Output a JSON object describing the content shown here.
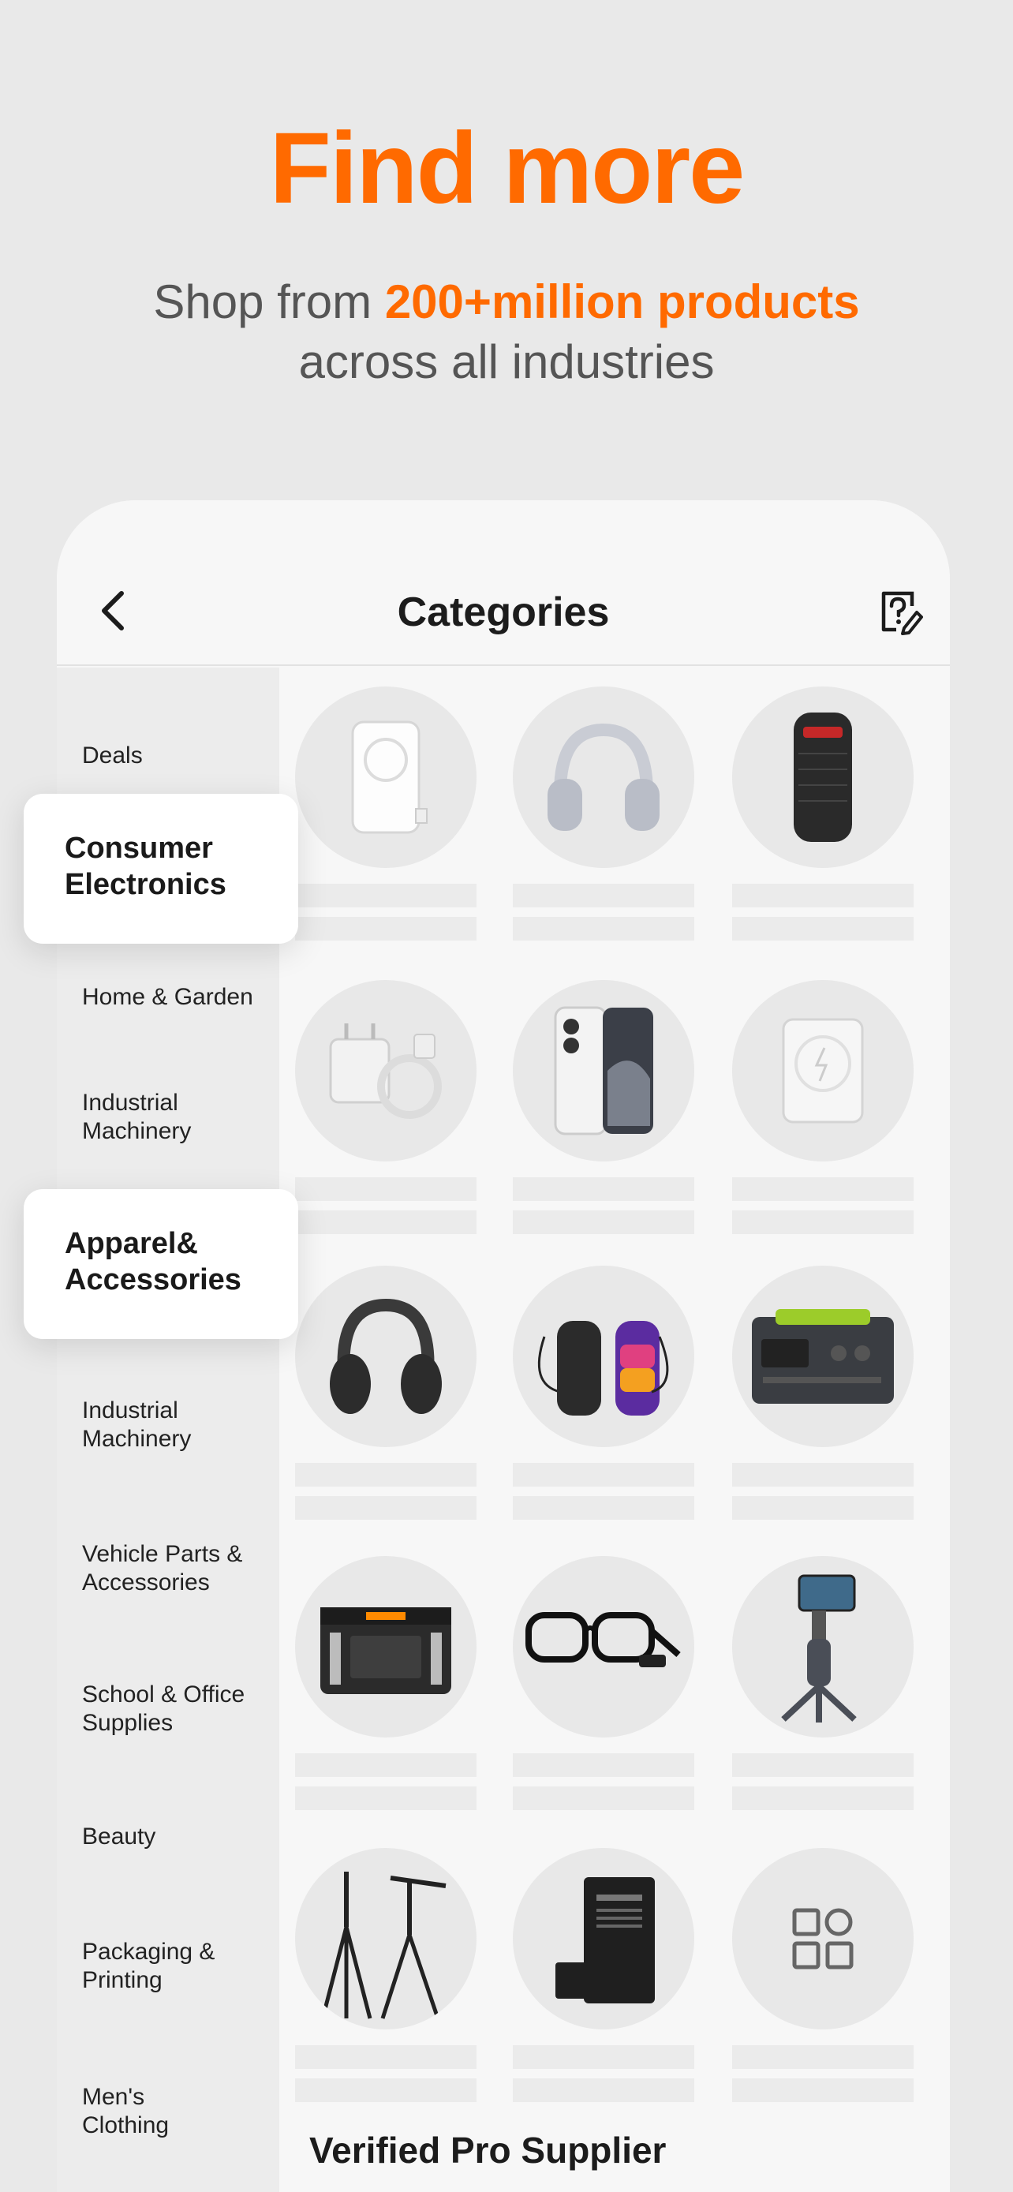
{
  "hero": {
    "title": "Find more",
    "subtitle_prefix": "Shop from ",
    "subtitle_accent": "200+million products",
    "subtitle_line2": "across all industries"
  },
  "colors": {
    "accent": "#ff6a00",
    "background": "#e9e9e9",
    "panel": "#f7f7f7"
  },
  "header": {
    "title": "Categories",
    "back_icon": "chevron-left-icon",
    "help_icon": "help-edit-icon"
  },
  "sidebar": {
    "items": [
      "Deals",
      "Home & Garden",
      "Industrial Machinery",
      "Industrial Machinery",
      "Vehicle Parts & Accessories",
      "School & Office Supplies",
      "Beauty",
      "Packaging & Printing",
      "Men's Clothing"
    ],
    "highlighted": [
      "Consumer Electronics",
      "Apparel& Accessories"
    ]
  },
  "products": [
    "power-bank-icon",
    "headphones-icon",
    "speaker-icon",
    "charger-cable-icon",
    "smartphone-icon",
    "magnetic-battery-icon",
    "headphones-dark-icon",
    "portable-speakers-icon",
    "power-station-icon",
    "generator-icon",
    "smart-glasses-icon",
    "gimbal-stabilizer-icon",
    "tripod-icon",
    "phone-battery-icon",
    "more-categories-icon"
  ],
  "footer": {
    "section_title": "Verified Pro Supplier"
  }
}
